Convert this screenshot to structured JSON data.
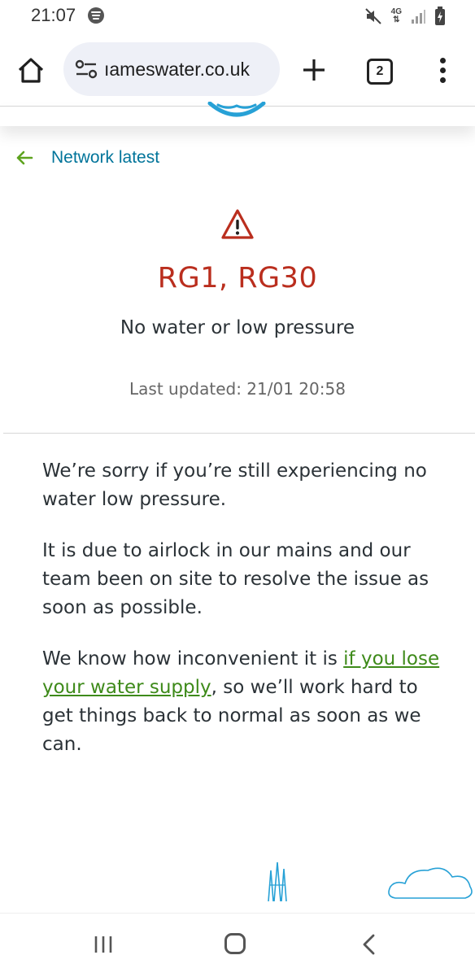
{
  "status_bar": {
    "time": "21:07",
    "network": "4G",
    "icons": [
      "spotify-icon",
      "mute-icon",
      "signal-icon",
      "battery-charging-icon"
    ]
  },
  "browser": {
    "url": "ıameswater.co.uk",
    "tab_count": "2",
    "icons": [
      "home-icon",
      "site-settings-icon",
      "new-tab-icon",
      "tab-switcher-icon",
      "more-menu-icon"
    ]
  },
  "page": {
    "back_link": "Network latest",
    "postcodes": "RG1, RG30",
    "incident_type": "No water or low pressure",
    "last_updated": "Last updated: 21/01 20:58",
    "paragraphs": {
      "p1": "We’re sorry if you’re still experiencing no water low pressure.",
      "p2": "It is due to airlock in our mains and our team been on site to resolve the issue as soon as possible.",
      "p3_before": "We know how inconvenient it is ",
      "p3_link": "if you lose your water supply",
      "p3_after": ", so we’ll work hard to get things back to normal as soon as we can."
    }
  },
  "colors": {
    "link_blue": "#00749a",
    "alert_red": "#ba2e1e",
    "link_green": "#3e8a1a",
    "arrow_green": "#5ea31f",
    "illustration_blue": "#27a1d6"
  },
  "nav_bar": {
    "icons": [
      "recent-apps-icon",
      "home-button-icon",
      "back-icon"
    ]
  }
}
